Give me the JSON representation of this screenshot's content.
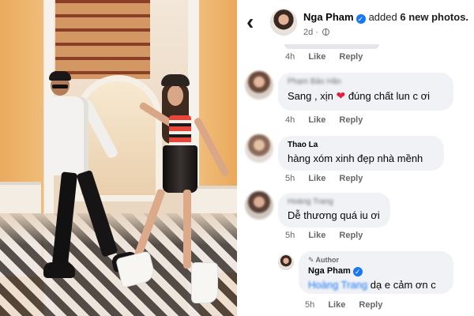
{
  "post": {
    "author": "Nga Pham",
    "action_prefix": "added",
    "action_count": "6 new photos.",
    "time": "2d"
  },
  "top_actions": {
    "time": "4h",
    "like": "Like",
    "reply": "Reply"
  },
  "comments": [
    {
      "name": "Phạm Bảo Hân",
      "text_before": "Sang , xịn",
      "text_after": "đúng chất lun c ơi",
      "time": "4h",
      "like": "Like",
      "reply": "Reply"
    },
    {
      "name": "Thao La",
      "text": "hàng xóm xinh đẹp nhà mềnh",
      "time": "5h",
      "like": "Like",
      "reply": "Reply"
    },
    {
      "name": "Hoàng Trang",
      "text": "Dễ thương quá iu ơi",
      "time": "5h",
      "like": "Like",
      "reply": "Reply"
    }
  ],
  "reply": {
    "badge": "Author",
    "name": "Nga Pham",
    "mention": "Hoàng Trang",
    "text": "dạ e cảm ơn c",
    "time": "5h",
    "like": "Like",
    "reply": "Reply"
  },
  "colors": {
    "accent": "#1877f2",
    "bubble": "#f0f2f5",
    "muted": "#65676b",
    "heart": "#e41e3f"
  }
}
